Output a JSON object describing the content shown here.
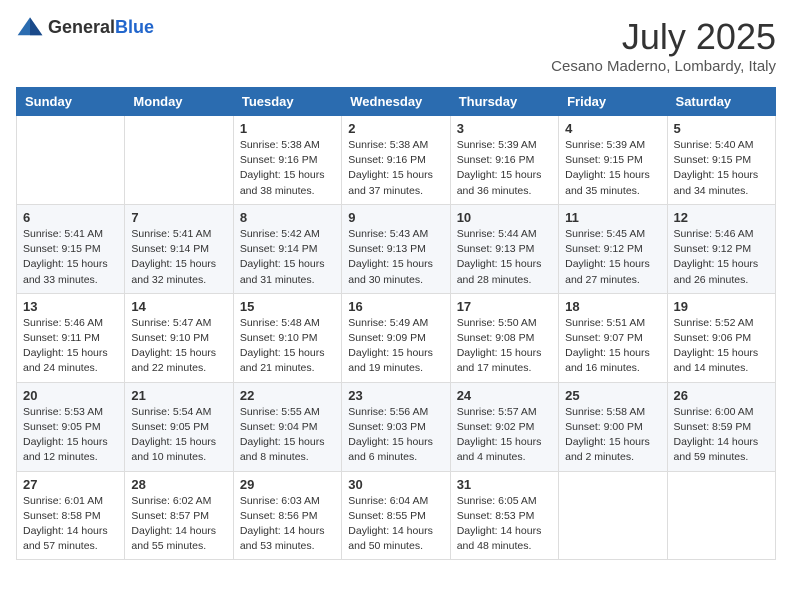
{
  "header": {
    "logo_general": "General",
    "logo_blue": "Blue",
    "month": "July 2025",
    "location": "Cesano Maderno, Lombardy, Italy"
  },
  "weekdays": [
    "Sunday",
    "Monday",
    "Tuesday",
    "Wednesday",
    "Thursday",
    "Friday",
    "Saturday"
  ],
  "weeks": [
    [
      {
        "day": "",
        "details": ""
      },
      {
        "day": "",
        "details": ""
      },
      {
        "day": "1",
        "details": "Sunrise: 5:38 AM\nSunset: 9:16 PM\nDaylight: 15 hours and 38 minutes."
      },
      {
        "day": "2",
        "details": "Sunrise: 5:38 AM\nSunset: 9:16 PM\nDaylight: 15 hours and 37 minutes."
      },
      {
        "day": "3",
        "details": "Sunrise: 5:39 AM\nSunset: 9:16 PM\nDaylight: 15 hours and 36 minutes."
      },
      {
        "day": "4",
        "details": "Sunrise: 5:39 AM\nSunset: 9:15 PM\nDaylight: 15 hours and 35 minutes."
      },
      {
        "day": "5",
        "details": "Sunrise: 5:40 AM\nSunset: 9:15 PM\nDaylight: 15 hours and 34 minutes."
      }
    ],
    [
      {
        "day": "6",
        "details": "Sunrise: 5:41 AM\nSunset: 9:15 PM\nDaylight: 15 hours and 33 minutes."
      },
      {
        "day": "7",
        "details": "Sunrise: 5:41 AM\nSunset: 9:14 PM\nDaylight: 15 hours and 32 minutes."
      },
      {
        "day": "8",
        "details": "Sunrise: 5:42 AM\nSunset: 9:14 PM\nDaylight: 15 hours and 31 minutes."
      },
      {
        "day": "9",
        "details": "Sunrise: 5:43 AM\nSunset: 9:13 PM\nDaylight: 15 hours and 30 minutes."
      },
      {
        "day": "10",
        "details": "Sunrise: 5:44 AM\nSunset: 9:13 PM\nDaylight: 15 hours and 28 minutes."
      },
      {
        "day": "11",
        "details": "Sunrise: 5:45 AM\nSunset: 9:12 PM\nDaylight: 15 hours and 27 minutes."
      },
      {
        "day": "12",
        "details": "Sunrise: 5:46 AM\nSunset: 9:12 PM\nDaylight: 15 hours and 26 minutes."
      }
    ],
    [
      {
        "day": "13",
        "details": "Sunrise: 5:46 AM\nSunset: 9:11 PM\nDaylight: 15 hours and 24 minutes."
      },
      {
        "day": "14",
        "details": "Sunrise: 5:47 AM\nSunset: 9:10 PM\nDaylight: 15 hours and 22 minutes."
      },
      {
        "day": "15",
        "details": "Sunrise: 5:48 AM\nSunset: 9:10 PM\nDaylight: 15 hours and 21 minutes."
      },
      {
        "day": "16",
        "details": "Sunrise: 5:49 AM\nSunset: 9:09 PM\nDaylight: 15 hours and 19 minutes."
      },
      {
        "day": "17",
        "details": "Sunrise: 5:50 AM\nSunset: 9:08 PM\nDaylight: 15 hours and 17 minutes."
      },
      {
        "day": "18",
        "details": "Sunrise: 5:51 AM\nSunset: 9:07 PM\nDaylight: 15 hours and 16 minutes."
      },
      {
        "day": "19",
        "details": "Sunrise: 5:52 AM\nSunset: 9:06 PM\nDaylight: 15 hours and 14 minutes."
      }
    ],
    [
      {
        "day": "20",
        "details": "Sunrise: 5:53 AM\nSunset: 9:05 PM\nDaylight: 15 hours and 12 minutes."
      },
      {
        "day": "21",
        "details": "Sunrise: 5:54 AM\nSunset: 9:05 PM\nDaylight: 15 hours and 10 minutes."
      },
      {
        "day": "22",
        "details": "Sunrise: 5:55 AM\nSunset: 9:04 PM\nDaylight: 15 hours and 8 minutes."
      },
      {
        "day": "23",
        "details": "Sunrise: 5:56 AM\nSunset: 9:03 PM\nDaylight: 15 hours and 6 minutes."
      },
      {
        "day": "24",
        "details": "Sunrise: 5:57 AM\nSunset: 9:02 PM\nDaylight: 15 hours and 4 minutes."
      },
      {
        "day": "25",
        "details": "Sunrise: 5:58 AM\nSunset: 9:00 PM\nDaylight: 15 hours and 2 minutes."
      },
      {
        "day": "26",
        "details": "Sunrise: 6:00 AM\nSunset: 8:59 PM\nDaylight: 14 hours and 59 minutes."
      }
    ],
    [
      {
        "day": "27",
        "details": "Sunrise: 6:01 AM\nSunset: 8:58 PM\nDaylight: 14 hours and 57 minutes."
      },
      {
        "day": "28",
        "details": "Sunrise: 6:02 AM\nSunset: 8:57 PM\nDaylight: 14 hours and 55 minutes."
      },
      {
        "day": "29",
        "details": "Sunrise: 6:03 AM\nSunset: 8:56 PM\nDaylight: 14 hours and 53 minutes."
      },
      {
        "day": "30",
        "details": "Sunrise: 6:04 AM\nSunset: 8:55 PM\nDaylight: 14 hours and 50 minutes."
      },
      {
        "day": "31",
        "details": "Sunrise: 6:05 AM\nSunset: 8:53 PM\nDaylight: 14 hours and 48 minutes."
      },
      {
        "day": "",
        "details": ""
      },
      {
        "day": "",
        "details": ""
      }
    ]
  ]
}
